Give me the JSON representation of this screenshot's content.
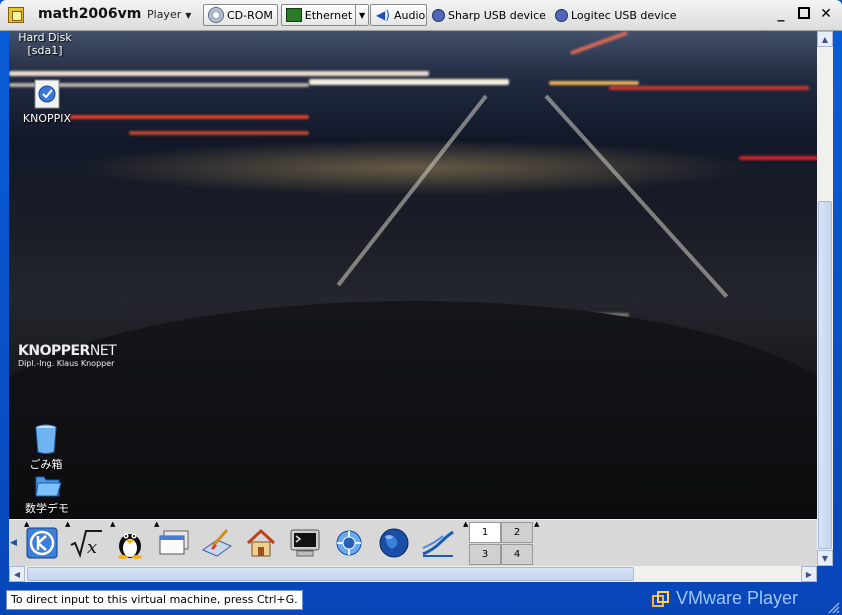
{
  "window": {
    "title": "math2006vm",
    "player_menu": "Player",
    "controls": [
      "minimize-icon",
      "maximize-icon",
      "close-icon"
    ]
  },
  "devices": [
    {
      "label": "CD-ROM",
      "icon": "cdrom-icon"
    },
    {
      "label": "Ethernet",
      "icon": "ethernet-icon"
    },
    {
      "label": "Audio",
      "icon": "speaker-icon"
    },
    {
      "label": "Sharp USB device",
      "icon": "usb-icon"
    },
    {
      "label": "Logitec USB device",
      "icon": "usb-icon"
    }
  ],
  "desktop": {
    "icons": [
      {
        "label_line1": "Hard Disk",
        "label_line2": "[sda1]"
      },
      {
        "label": "KNOPPIX"
      },
      {
        "label": "ごみ箱"
      },
      {
        "label": "数学デモ"
      }
    ],
    "brand_line1_a": "KNOPPER",
    "brand_line1_b": "NET",
    "brand_line2": "Dipl.-Ing. Klaus Knopper"
  },
  "panel": {
    "pager": [
      "1",
      "2",
      "3",
      "4"
    ]
  },
  "status": {
    "message": "To direct input to this virtual machine, press Ctrl+G.",
    "brand": "VMware Player"
  }
}
